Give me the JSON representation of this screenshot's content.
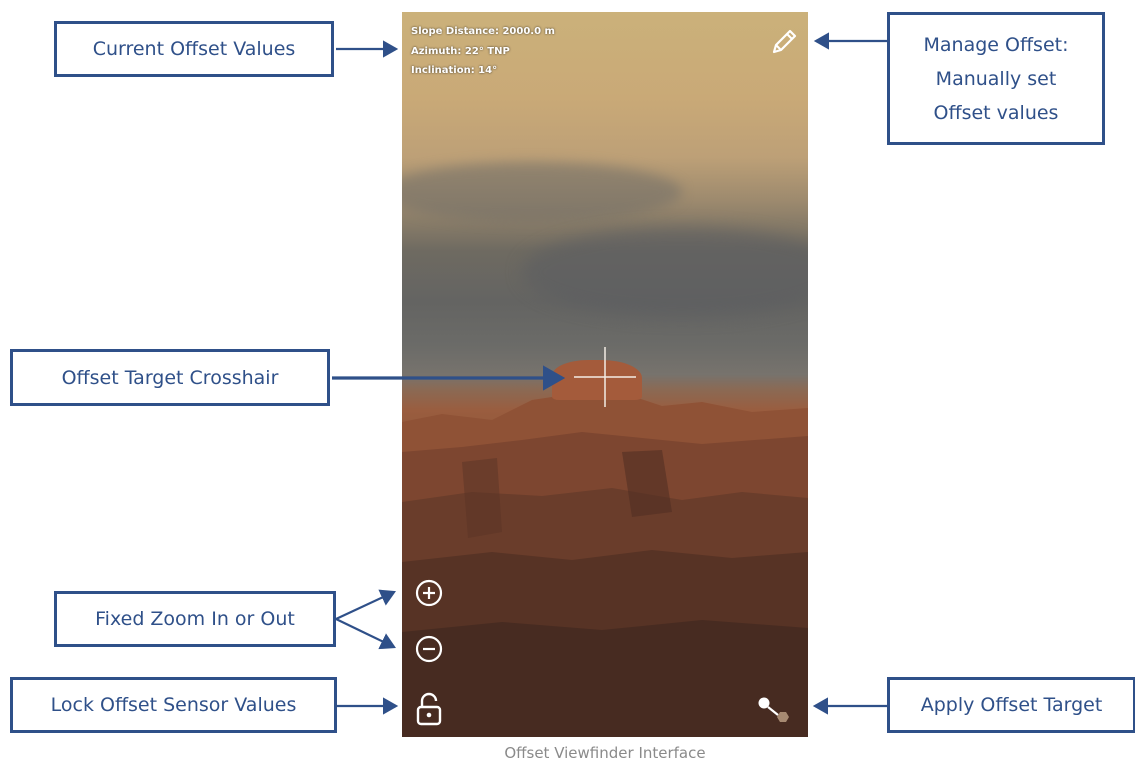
{
  "viewfinder": {
    "slope_distance": "Slope Distance: 2000.0 m",
    "azimuth": "Azimuth: 22° TNP",
    "inclination": "Inclination: 14°"
  },
  "callouts": {
    "current_offset_values": "Current Offset Values",
    "manage_offset_line1": "Manage Offset:",
    "manage_offset_line2": "Manually set",
    "manage_offset_line3": "Offset values",
    "offset_target_crosshair": "Offset Target Crosshair",
    "fixed_zoom": "Fixed Zoom In or Out",
    "lock_offset_sensor": "Lock Offset Sensor Values",
    "apply_offset_target": "Apply Offset Target"
  },
  "caption": "Offset Viewfinder Interface",
  "icons": [
    "pencil-icon",
    "zoom-in-icon",
    "zoom-out-icon",
    "unlock-icon",
    "apply-target-icon",
    "crosshair-icon"
  ],
  "colors": {
    "callout_border": "#2f5089",
    "callout_text": "#2f5089",
    "caption": "#8a8a8a"
  }
}
